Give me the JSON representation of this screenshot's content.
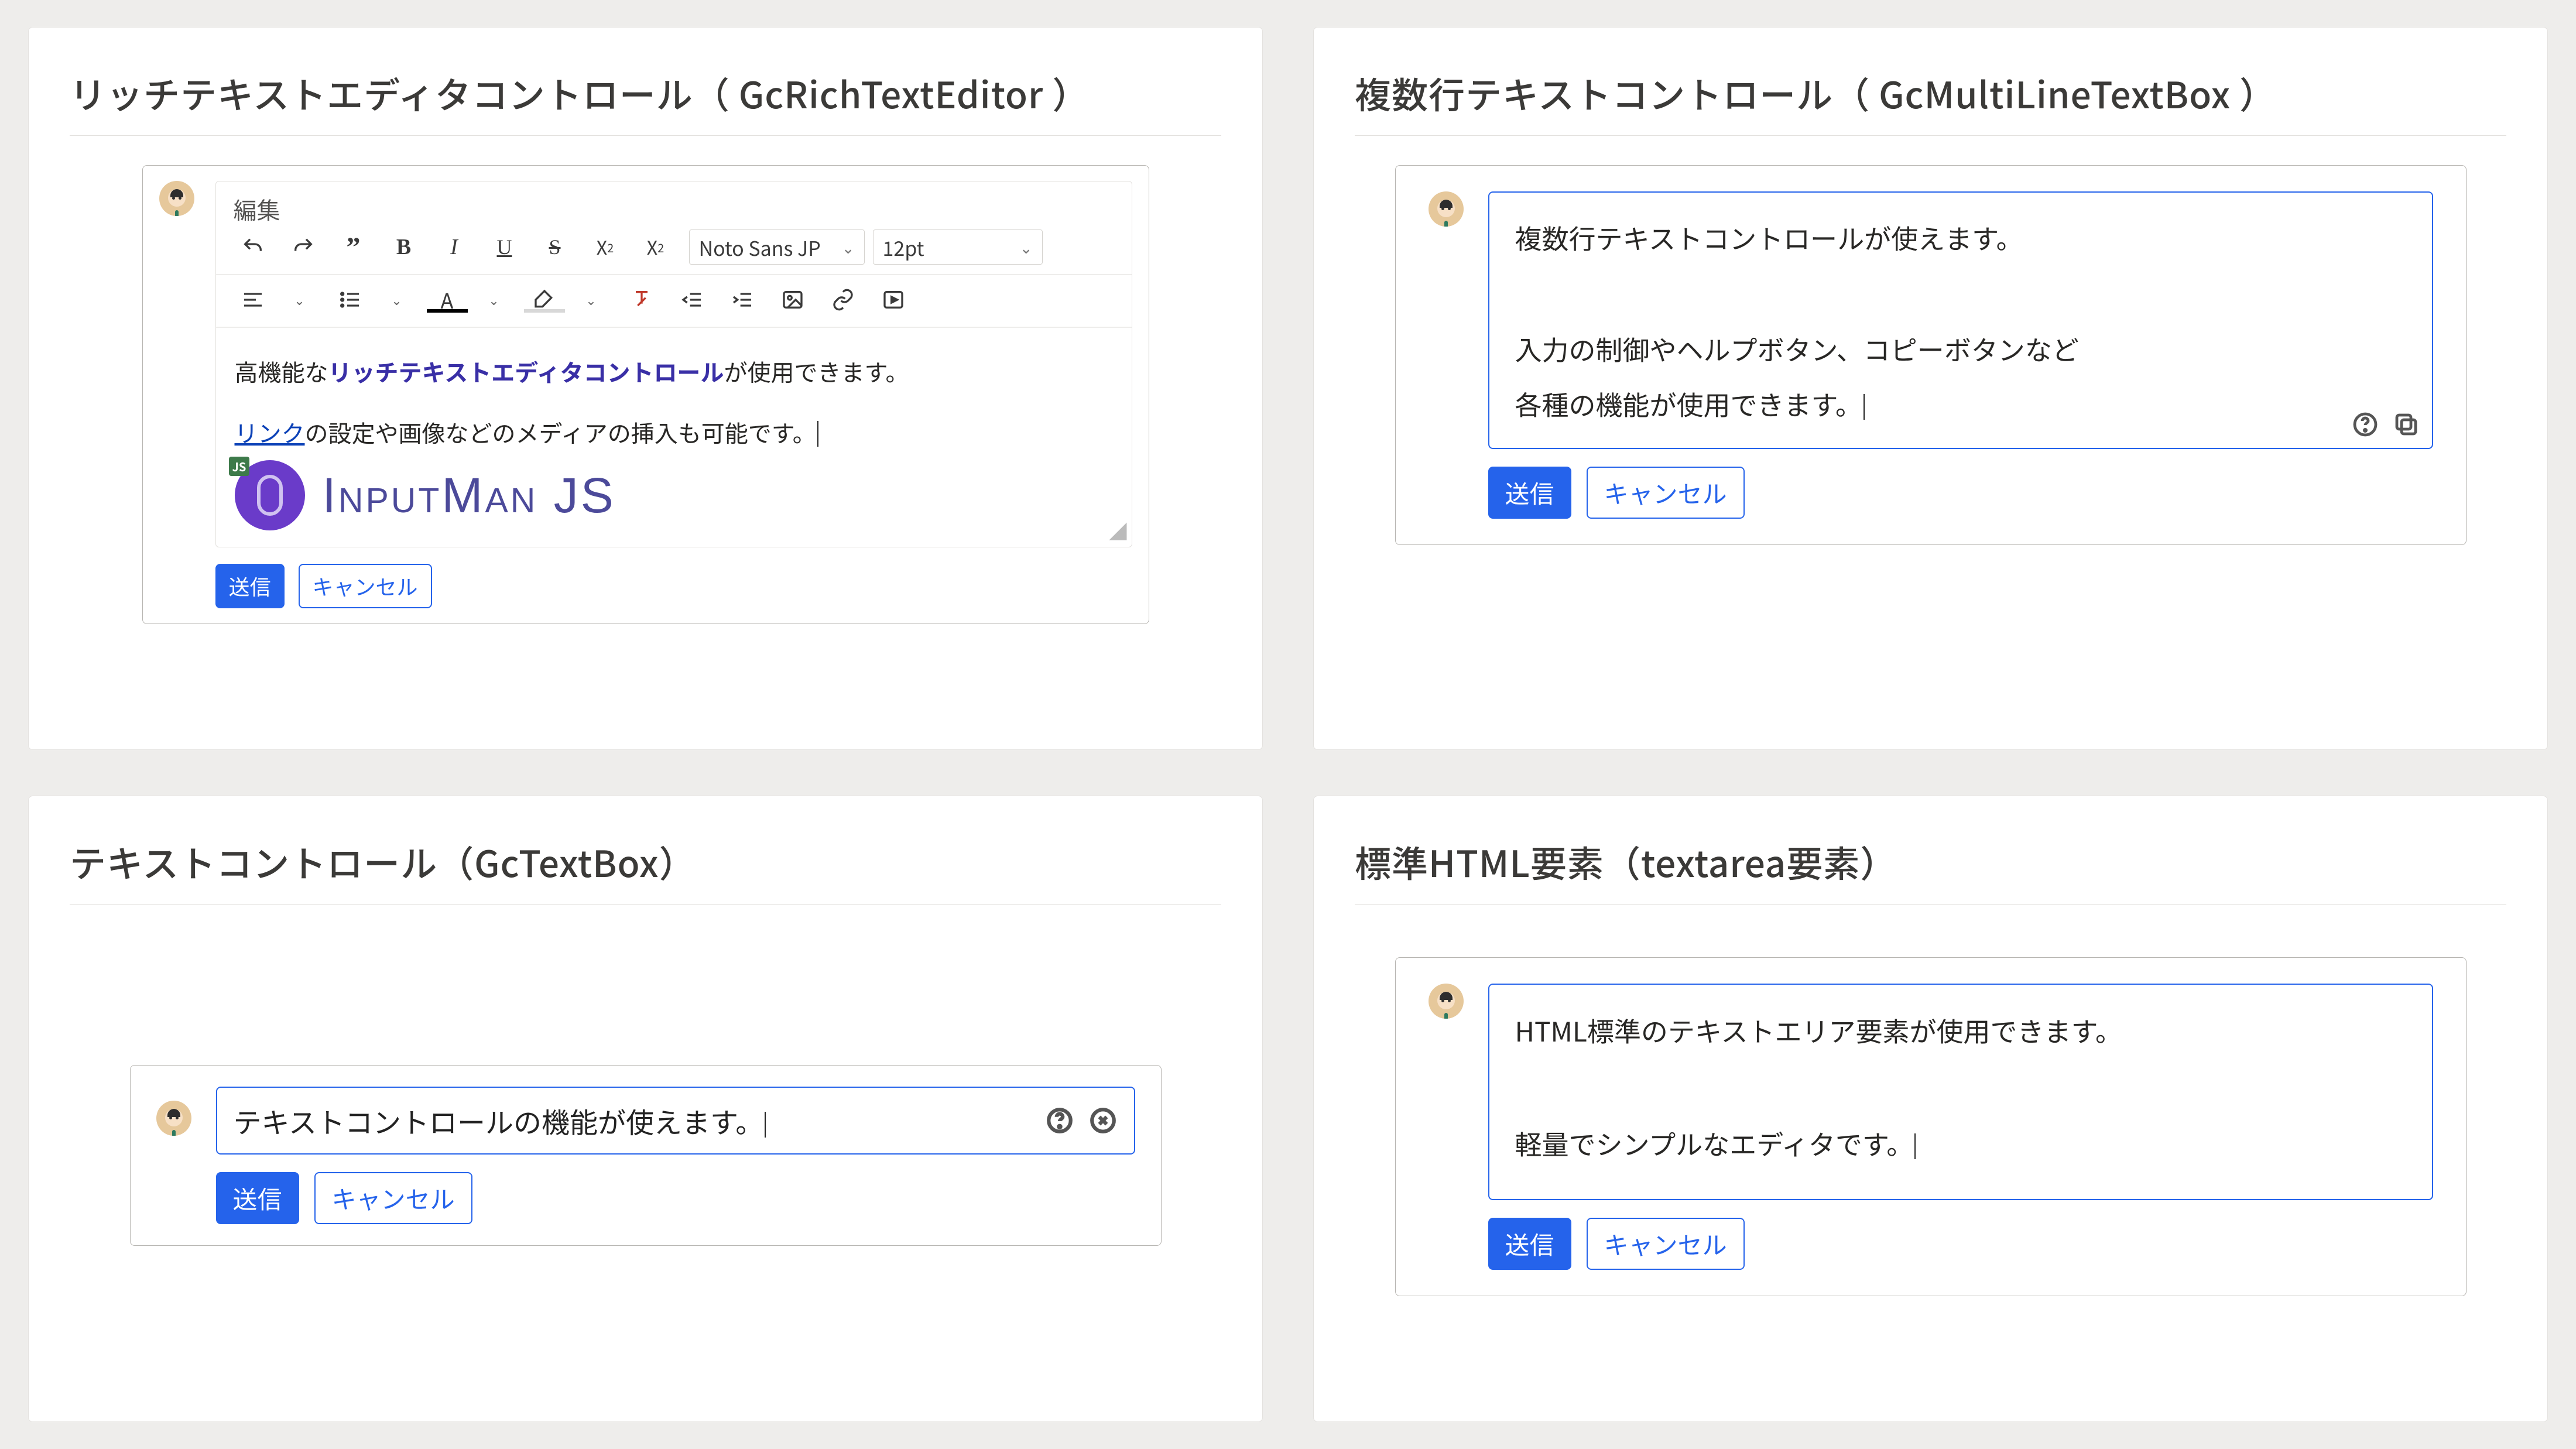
{
  "common": {
    "send": "送信",
    "cancel": "キャンセル"
  },
  "rte": {
    "title": "リッチテキストエディタコントロール（ GcRichTextEditor ）",
    "menu_edit": "編集",
    "font_family": "Noto Sans JP",
    "font_size": "12pt",
    "body_prefix": "高機能な",
    "body_emphasis": "リッチテキストエディタコントロール",
    "body_suffix": "が使用できます。",
    "body2_link": "リンク",
    "body2_rest": "の設定や画像などのメディアの挿入も可能です。",
    "logo_text": "InputMan JS"
  },
  "ml": {
    "title": "複数行テキストコントロール（ GcMultiLineTextBox ）",
    "lines": [
      "複数行テキストコントロールが使えます。",
      "",
      "入力の制御やヘルプボタン、コピーボタンなど",
      "各種の機能が使用できます。"
    ]
  },
  "tb": {
    "title": "テキストコントロール（GcTextBox）",
    "value": "テキストコントロールの機能が使えます。"
  },
  "ta": {
    "title": "標準HTML要素（textarea要素）",
    "lines": [
      "HTML標準のテキストエリア要素が使用できます。",
      "",
      "軽量でシンプルなエディタです。"
    ]
  }
}
